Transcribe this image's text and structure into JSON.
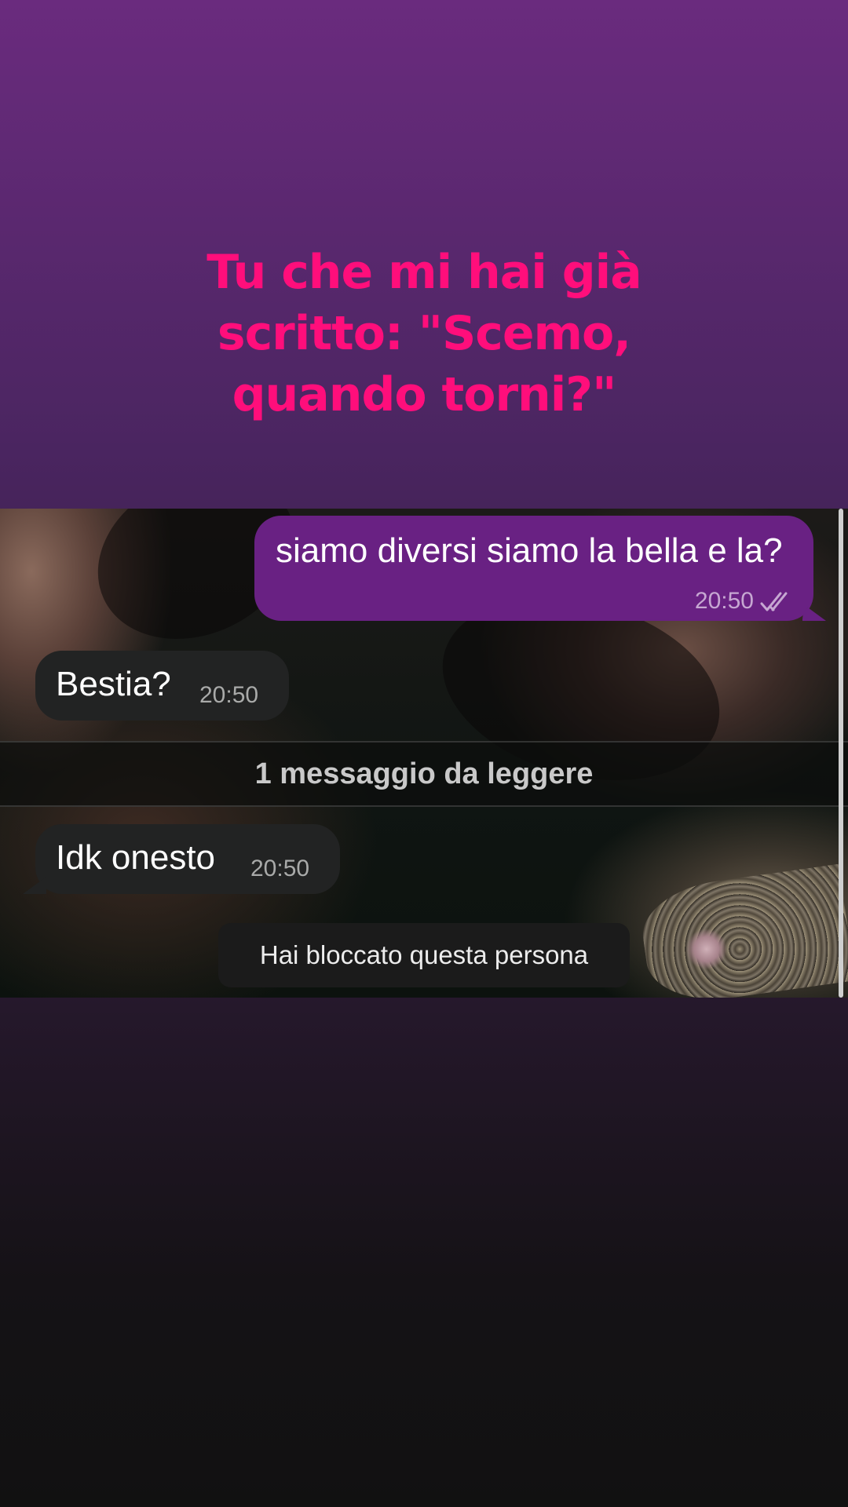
{
  "story": {
    "caption_lines": [
      "Tu che mi hai già",
      "scritto: \"Scemo,",
      "quando torni?\""
    ]
  },
  "chat": {
    "messages": [
      {
        "direction": "outgoing",
        "text": "siamo diversi siamo la bella e la?",
        "time": "20:50",
        "status_icon": "double-check-icon"
      },
      {
        "direction": "incoming",
        "text": "Bestia?",
        "time": "20:50"
      },
      {
        "direction": "incoming",
        "text": "Idk onesto",
        "time": "20:50"
      }
    ],
    "unread_divider": "1 messaggio da leggere",
    "blocked_notice": "Hai bloccato questa persona"
  },
  "colors": {
    "caption": "#ff0e7b",
    "outgoing_bubble": "#692183",
    "incoming_bubble": "#222323",
    "background_top": "#6a2b7e",
    "background_bottom": "#111111"
  }
}
